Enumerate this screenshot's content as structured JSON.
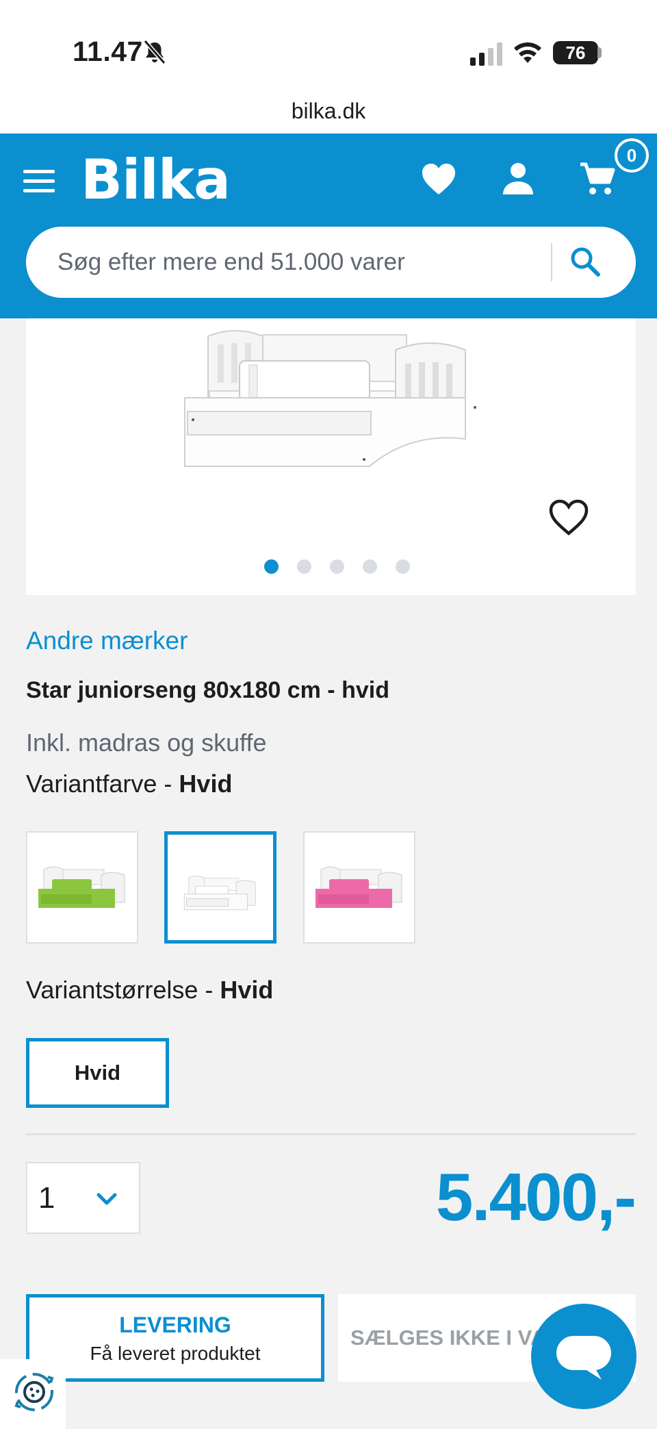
{
  "status_bar": {
    "time": "11.47",
    "battery": "76"
  },
  "browser": {
    "url": "bilka.dk"
  },
  "header": {
    "logo": "Bilka",
    "cart_count": "0",
    "search_placeholder": "Søg efter mere end 51.000 varer",
    "brand_color": "#0b8fcf"
  },
  "gallery": {
    "image_count": 5,
    "active_index": 0
  },
  "product": {
    "brand": "Andre mærker",
    "title": "Star juniorseng 80x180 cm - hvid",
    "subtitle": "Inkl. madras og skuffe",
    "variant_color_label": "Variantfarve - ",
    "variant_color_value": "Hvid",
    "swatches": [
      {
        "color": "green",
        "accent": "#8cc63f"
      },
      {
        "color": "white",
        "accent": "#f4f4f4",
        "selected": true
      },
      {
        "color": "pink",
        "accent": "#ec6aa8"
      }
    ],
    "variant_size_label": "Variantstørrelse - ",
    "variant_size_value": "Hvid",
    "size_option": "Hvid",
    "quantity": "1",
    "price": "5.400,-"
  },
  "actions": {
    "delivery_title": "LEVERING",
    "delivery_subtitle": "Få leveret produktet",
    "store_label": "SÆLGES IKKE I VAREHUS"
  }
}
